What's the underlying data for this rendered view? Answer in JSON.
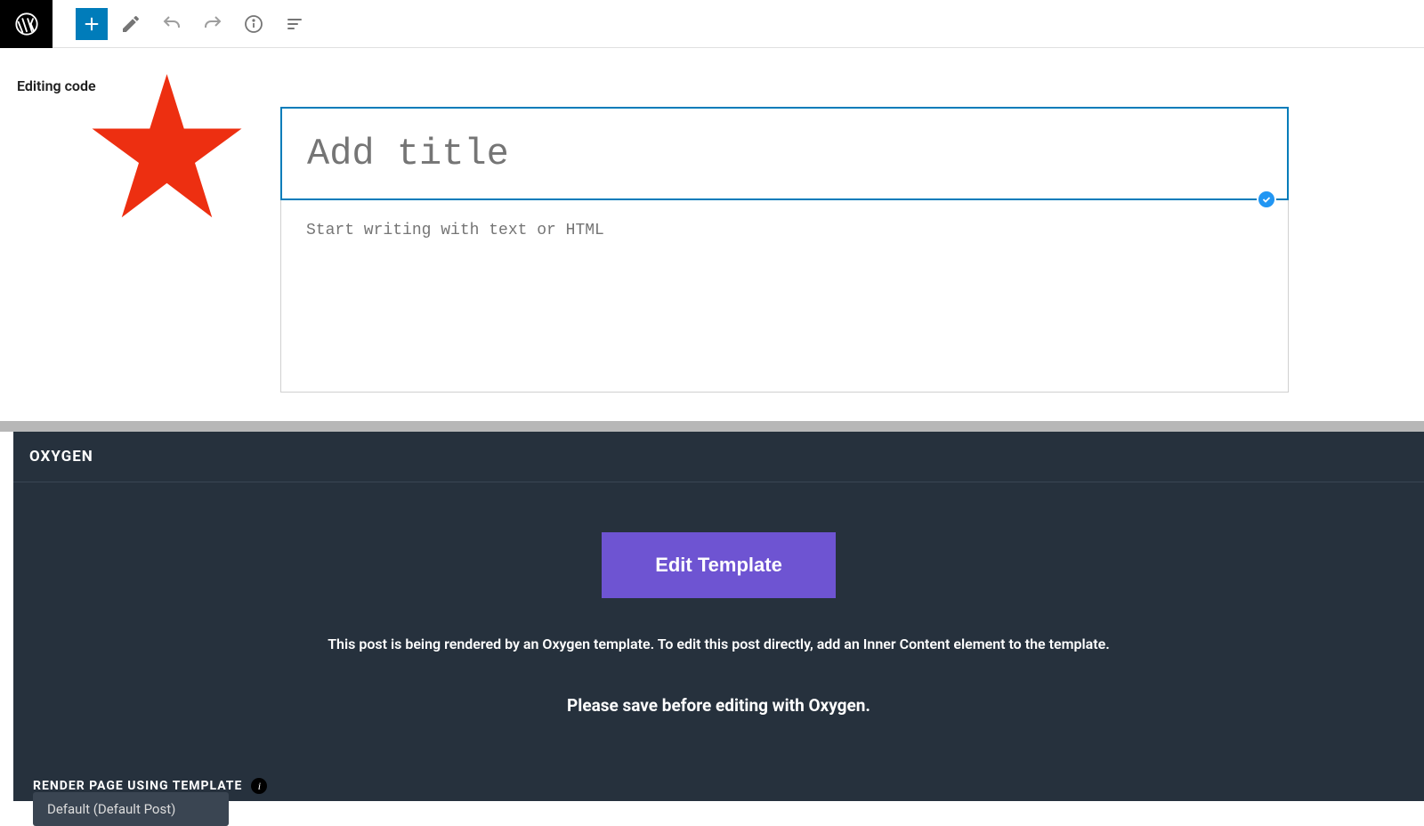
{
  "toolbar": {
    "editing_label": "Editing code"
  },
  "editor": {
    "title_placeholder": "Add title",
    "content_placeholder": "Start writing with text or HTML"
  },
  "oxygen": {
    "title": "OXYGEN",
    "edit_template_btn": "Edit Template",
    "message_rendered": "This post is being rendered by an Oxygen template. To edit this post directly, add an Inner Content element to the template.",
    "message_save": "Please save before editing with Oxygen.",
    "render_label": "RENDER PAGE USING TEMPLATE",
    "render_select_value": "Default (Default Post)"
  },
  "colors": {
    "accent": "#007cba",
    "star": "#ed2f11",
    "oxygen_bg": "#26313d",
    "edit_btn": "#6e54d2"
  }
}
